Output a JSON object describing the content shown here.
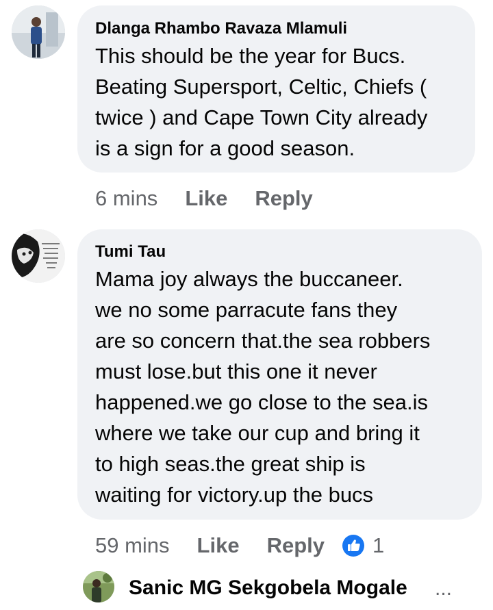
{
  "comments": [
    {
      "author": "Dlanga Rhambo Ravaza Mlamuli",
      "lines": [
        "This should be the year for Bucs.",
        "Beating Supersport, Celtic, Chiefs (",
        "twice ) and Cape Town City already",
        "is a sign for a good season."
      ],
      "time": "6 mins",
      "like_label": "Like",
      "reply_label": "Reply"
    },
    {
      "author": "Tumi Tau",
      "lines": [
        "Mama joy always the buccaneer.",
        "we no some parracute fans they",
        "are so concern that.the sea robbers",
        "must lose.but this one it never",
        "happened.we go close to the sea.is",
        "where we take our cup and bring it",
        "to high seas.the great ship is",
        "waiting for victory.up the bucs"
      ],
      "time": "59 mins",
      "like_label": "Like",
      "reply_label": "Reply",
      "reaction_count": "1"
    }
  ],
  "next_comment": {
    "author": "Sanic MG Sekgobela Mogale",
    "more": "..."
  },
  "colors": {
    "bubble": "#f0f2f5",
    "muted": "#65676b",
    "like_blue": "#1877f2"
  }
}
